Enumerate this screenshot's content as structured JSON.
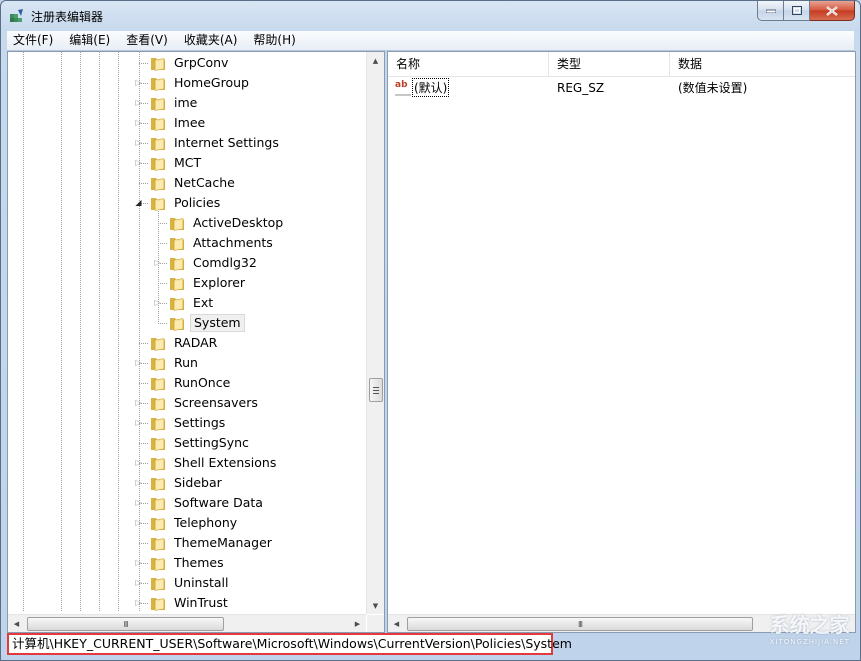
{
  "window": {
    "title": "注册表编辑器",
    "controls": {
      "minimize": "minimize",
      "maximize": "maximize",
      "close": "close"
    }
  },
  "menu": [
    {
      "label": "文件(F)"
    },
    {
      "label": "编辑(E)"
    },
    {
      "label": "查看(V)"
    },
    {
      "label": "收藏夹(A)"
    },
    {
      "label": "帮助(H)"
    }
  ],
  "tree": {
    "nodes": [
      {
        "label": "GrpConv",
        "level": 0,
        "expander": "none"
      },
      {
        "label": "HomeGroup",
        "level": 0,
        "expander": "collapsed"
      },
      {
        "label": "ime",
        "level": 0,
        "expander": "collapsed"
      },
      {
        "label": "Imee",
        "level": 0,
        "expander": "collapsed"
      },
      {
        "label": "Internet Settings",
        "level": 0,
        "expander": "collapsed"
      },
      {
        "label": "MCT",
        "level": 0,
        "expander": "collapsed"
      },
      {
        "label": "NetCache",
        "level": 0,
        "expander": "none"
      },
      {
        "label": "Policies",
        "level": 0,
        "expander": "expanded"
      },
      {
        "label": "ActiveDesktop",
        "level": 1,
        "expander": "none"
      },
      {
        "label": "Attachments",
        "level": 1,
        "expander": "none"
      },
      {
        "label": "Comdlg32",
        "level": 1,
        "expander": "collapsed"
      },
      {
        "label": "Explorer",
        "level": 1,
        "expander": "none"
      },
      {
        "label": "Ext",
        "level": 1,
        "expander": "collapsed"
      },
      {
        "label": "System",
        "level": 1,
        "expander": "none",
        "selected": true
      },
      {
        "label": "RADAR",
        "level": 0,
        "expander": "none"
      },
      {
        "label": "Run",
        "level": 0,
        "expander": "collapsed"
      },
      {
        "label": "RunOnce",
        "level": 0,
        "expander": "none"
      },
      {
        "label": "Screensavers",
        "level": 0,
        "expander": "collapsed"
      },
      {
        "label": "Settings",
        "level": 0,
        "expander": "collapsed"
      },
      {
        "label": "SettingSync",
        "level": 0,
        "expander": "none"
      },
      {
        "label": "Shell Extensions",
        "level": 0,
        "expander": "collapsed"
      },
      {
        "label": "Sidebar",
        "level": 0,
        "expander": "collapsed"
      },
      {
        "label": "Software Data",
        "level": 0,
        "expander": "collapsed"
      },
      {
        "label": "Telephony",
        "level": 0,
        "expander": "collapsed"
      },
      {
        "label": "ThemeManager",
        "level": 0,
        "expander": "none"
      },
      {
        "label": "Themes",
        "level": 0,
        "expander": "collapsed"
      },
      {
        "label": "Uninstall",
        "level": 0,
        "expander": "collapsed"
      },
      {
        "label": "WinTrust",
        "level": 0,
        "expander": "collapsed"
      }
    ],
    "hscroll_grip": "III"
  },
  "values": {
    "columns": [
      {
        "label": "名称"
      },
      {
        "label": "类型"
      },
      {
        "label": "数据"
      }
    ],
    "rows": [
      {
        "icon": "ab",
        "name": "(默认)",
        "type": "REG_SZ",
        "data": "(数值未设置)"
      }
    ],
    "hscroll_grip": "III"
  },
  "statusbar": {
    "path": "计算机\\HKEY_CURRENT_USER\\Software\\Microsoft\\Windows\\CurrentVersion\\Policies\\System"
  },
  "watermark": {
    "text": "系统之家",
    "subtext": "XITONGZHIJIA.NET"
  },
  "colors": {
    "highlight_border": "#e33a3f",
    "folder": "#e8c65a",
    "close_button": "#c9452a"
  }
}
